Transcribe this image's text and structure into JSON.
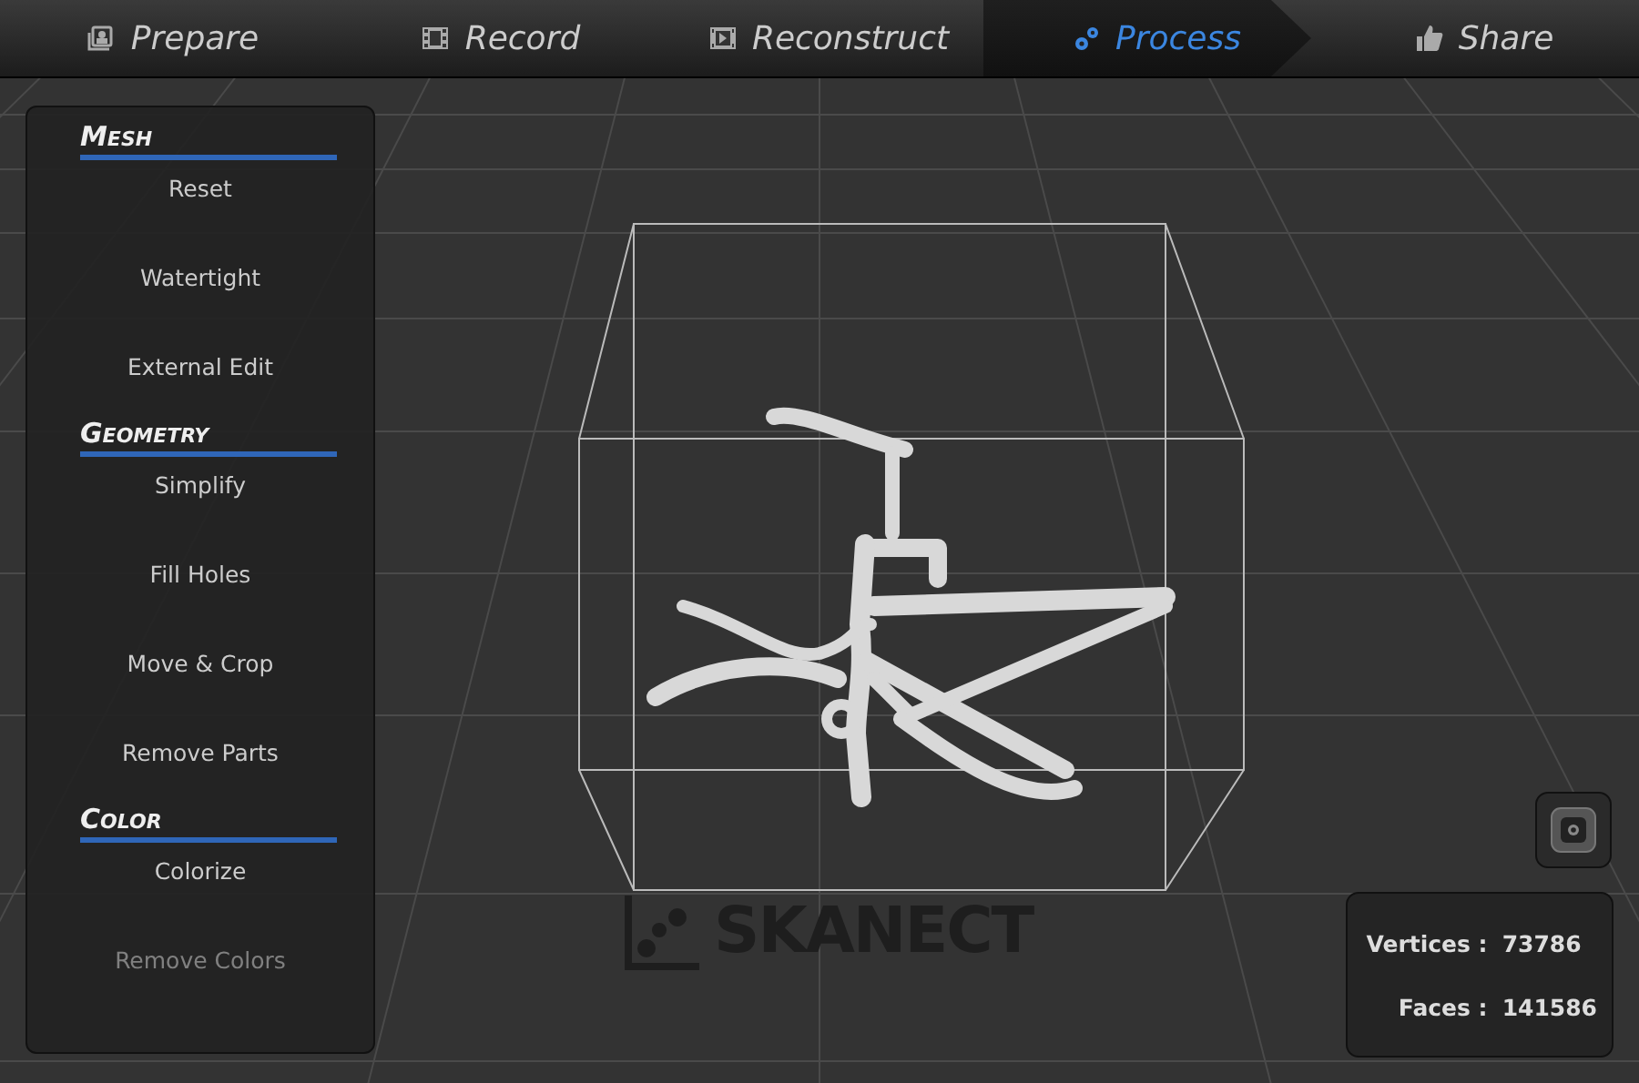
{
  "tabs": [
    {
      "label": "Prepare",
      "selected": false
    },
    {
      "label": "Record",
      "selected": false
    },
    {
      "label": "Reconstruct",
      "selected": false
    },
    {
      "label": "Process",
      "selected": true
    },
    {
      "label": "Share",
      "selected": false
    }
  ],
  "panel": {
    "sections": [
      {
        "title": "Mesh",
        "items": [
          "Reset",
          "Watertight",
          "External Edit"
        ]
      },
      {
        "title": "Geometry",
        "items": [
          "Simplify",
          "Fill Holes",
          "Move & Crop",
          "Remove Parts"
        ]
      },
      {
        "title": "Color",
        "items": [
          "Colorize",
          "Remove Colors"
        ]
      }
    ]
  },
  "logo": "SKANECT",
  "stats": [
    {
      "label": "Vertices :",
      "value": "73786"
    },
    {
      "label": "Faces :",
      "value": "141586"
    }
  ]
}
